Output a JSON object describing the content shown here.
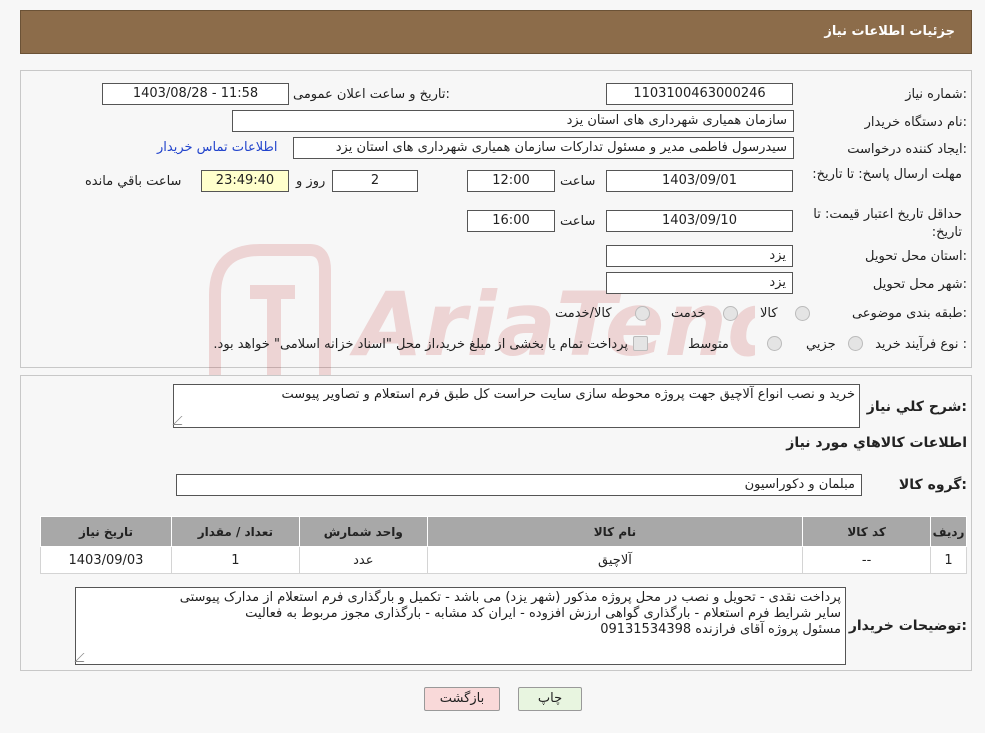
{
  "header": {
    "title": "جزئیات اطلاعات نیاز"
  },
  "form": {
    "need_number_label": "شماره نیاز:",
    "need_number": "1103100463000246",
    "announce_label": "تاریخ و ساعت اعلان عمومی:",
    "announce_value": "1403/08/28 - 11:58",
    "buyer_org_label": "نام دستگاه خریدار:",
    "buyer_org": "سازمان همیاری شهرداری های استان یزد",
    "creator_label": "ایجاد کننده درخواست:",
    "creator": "سیدرسول فاطمی مدیر و مسئول تدارکات سازمان همیاری شهرداری های استان یزد",
    "contact_link": "اطلاعات تماس خریدار",
    "deadline_label": "مهلت ارسال پاسخ: تا تاریخ:",
    "deadline_date": "1403/09/01",
    "time_label": "ساعت",
    "deadline_time": "12:00",
    "days_value": "2",
    "days_label": "روز و",
    "remaining_time": "23:49:40",
    "remaining_label": "ساعت باقي مانده",
    "validity_label": "حداقل تاریخ اعتبار قیمت: تا تاریخ:",
    "validity_date": "1403/09/10",
    "validity_time_label": "ساعت",
    "validity_time": "16:00",
    "province_label": "استان محل تحویل:",
    "province": "یزد",
    "city_label": "شهر محل تحویل:",
    "city": "یزد",
    "category_label": "طبقه بندی موضوعی:",
    "category_options": [
      "کالا",
      "خدمت",
      "کالا/خدمت"
    ],
    "process_label": "نوع فرآیند خرید :",
    "process_options": [
      "جزیي",
      "متوسط"
    ],
    "process_note": "پرداخت تمام یا بخشی از مبلغ خرید،از محل \"اسناد خزانه اسلامی\" خواهد بود."
  },
  "summary": {
    "desc_label": "شرح کلي نياز:",
    "desc_value": "خرید و نصب انواع آلاچیق جهت پروژه محوطه سازی سایت حراست کل طبق فرم استعلام و تصاویر پیوست",
    "goods_title": "اطلاعات کالاهاي مورد نياز",
    "group_label": "گروه کالا:",
    "group_value": "مبلمان و دکوراسیون"
  },
  "table": {
    "headers": [
      "رديف",
      "کد کالا",
      "نام کالا",
      "واحد شمارش",
      "تعداد / مقدار",
      "تاريخ نياز"
    ],
    "rows": [
      [
        "1",
        "--",
        "آلاچیق",
        "عدد",
        "1",
        "1403/09/03"
      ]
    ]
  },
  "notes": {
    "label": "توضیحات خریدار:",
    "line1": "پرداخت نقدی - تحویل و نصب در محل پروژه مذکور (شهر یزد) می باشد - تکمیل و بارگذاری فرم استعلام از مدارک پیوستی",
    "line2": "سایر شرایط فرم استعلام - بارگذاری گواهی ارزش افزوده - ایران کد مشابه - بارگذاری مجوز مربوط به فعالیت",
    "line3": "مسئول پروژه آقای فرازنده 09131534398"
  },
  "buttons": {
    "print": "چاپ",
    "back": "بازگشت"
  },
  "colors": {
    "header": "#8c6c4a",
    "back_button": "#f9d9d9",
    "print_button": "#e8f5e0"
  }
}
